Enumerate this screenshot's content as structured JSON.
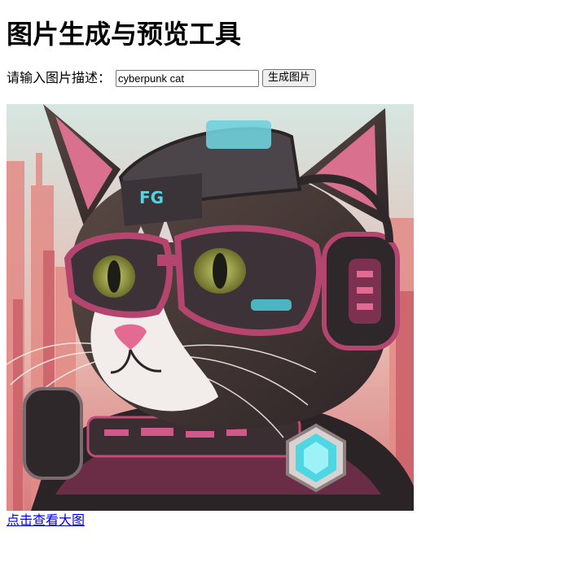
{
  "page": {
    "title": "图片生成与预览工具"
  },
  "form": {
    "prompt_label": "请输入图片描述：",
    "prompt_value": "cyberpunk cat",
    "generate_button_label": "生成图片"
  },
  "preview": {
    "image_subject": "cyberpunk cat with goggles and headphones",
    "view_large_link_label": "点击查看大图"
  },
  "colors": {
    "link": "#0000ee",
    "button_bg": "#efefef",
    "neon_cyan": "#4fd6e3",
    "neon_pink": "#d94f7a",
    "sky": "#cfe0dc"
  }
}
